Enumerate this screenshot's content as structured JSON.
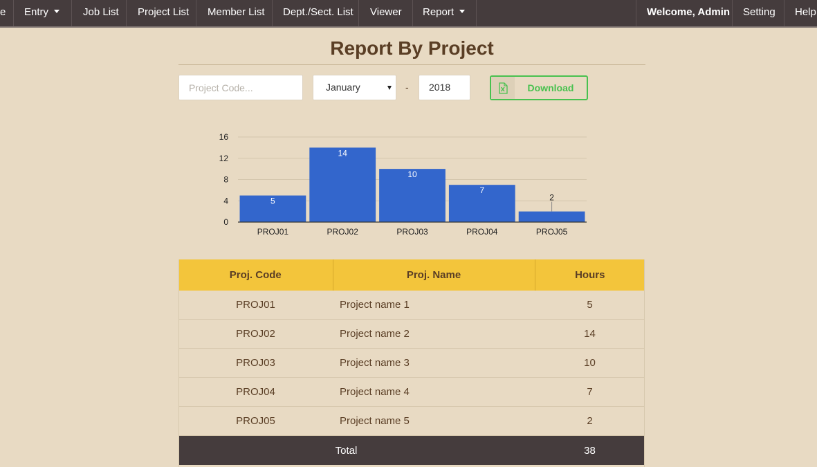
{
  "nav": {
    "partial_item": "e",
    "entry": "Entry",
    "job_list": "Job List",
    "project_list": "Project List",
    "member_list": "Member List",
    "dept_list": "Dept./Sect. List",
    "viewer": "Viewer",
    "report": "Report",
    "welcome": "Welcome, Admin",
    "setting": "Setting",
    "help": "Help"
  },
  "page": {
    "title": "Report By Project"
  },
  "filters": {
    "project_code_placeholder": "Project Code...",
    "month": "January",
    "separator": "-",
    "year": "2018",
    "download_label": "Download",
    "download_icon": "excel-file-icon"
  },
  "colors": {
    "accent": "#48c14f",
    "bar": "#3366cc",
    "header": "#f3c53b",
    "navbar": "#453c3d"
  },
  "chart_data": {
    "type": "bar",
    "categories": [
      "PROJ01",
      "PROJ02",
      "PROJ03",
      "PROJ04",
      "PROJ05"
    ],
    "values": [
      5,
      14,
      10,
      7,
      2
    ],
    "ylim": [
      0,
      16
    ],
    "yticks": [
      0,
      4,
      8,
      12,
      16
    ],
    "grid": true
  },
  "table": {
    "headers": [
      "Proj. Code",
      "Proj. Name",
      "Hours"
    ],
    "rows": [
      {
        "code": "PROJ01",
        "name": "Project name 1",
        "hours": "5"
      },
      {
        "code": "PROJ02",
        "name": "Project name 2",
        "hours": "14"
      },
      {
        "code": "PROJ03",
        "name": "Project name 3",
        "hours": "10"
      },
      {
        "code": "PROJ04",
        "name": "Project name 4",
        "hours": "7"
      },
      {
        "code": "PROJ05",
        "name": "Project name 5",
        "hours": "2"
      }
    ],
    "total_label": "Total",
    "total_hours": "38"
  }
}
